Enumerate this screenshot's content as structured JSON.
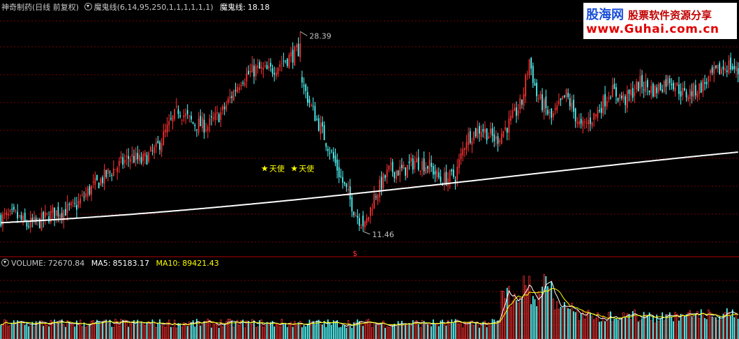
{
  "header": {
    "stock_name": "神奇制药",
    "period": "(日线 前复权)",
    "indicator_label": "魔鬼线(6,14,95,250,1,1,1,1,1,1)",
    "line_label": "魔鬼线:",
    "line_value": "18.18"
  },
  "volume_header": {
    "volume_label": "VOLUME:",
    "volume_value": "72670.84",
    "ma5_label": "MA5:",
    "ma5_value": "85183.17",
    "ma10_label": "MA10:",
    "ma10_value": "89421.43"
  },
  "watermark": {
    "brand": "股海网",
    "slogan": "股票软件资源分享",
    "url": "www.Guhai.com.cn"
  },
  "colors": {
    "background": "#000000",
    "up": "#ff3232",
    "down": "#54ffff",
    "ma_line": "#ffffff",
    "grid": "#7a0000",
    "text": "#c0c0c0",
    "ma5": "#ffffff",
    "ma10": "#ffff00",
    "signal": "#ffff00"
  },
  "chart_data": [
    {
      "type": "candlestick",
      "title": "神奇制药",
      "ylim": [
        9.5,
        30.0
      ],
      "max_label": "28.39",
      "min_label": "11.46",
      "signal_marker": "$",
      "signals": [
        {
          "index": 143,
          "label": "天使",
          "price": 16.8
        },
        {
          "index": 159,
          "label": "天使",
          "price": 16.8
        }
      ],
      "ma_line": {
        "name": "魔鬼线",
        "start": 12.2,
        "end": 18.18
      },
      "ohlc": []
    },
    {
      "type": "bar",
      "title": "VOLUME",
      "ylim": [
        0,
        140000
      ],
      "series": [
        {
          "name": "MA5",
          "last": 85183.17
        },
        {
          "name": "MA10",
          "last": 89421.43
        }
      ],
      "volume": []
    }
  ]
}
